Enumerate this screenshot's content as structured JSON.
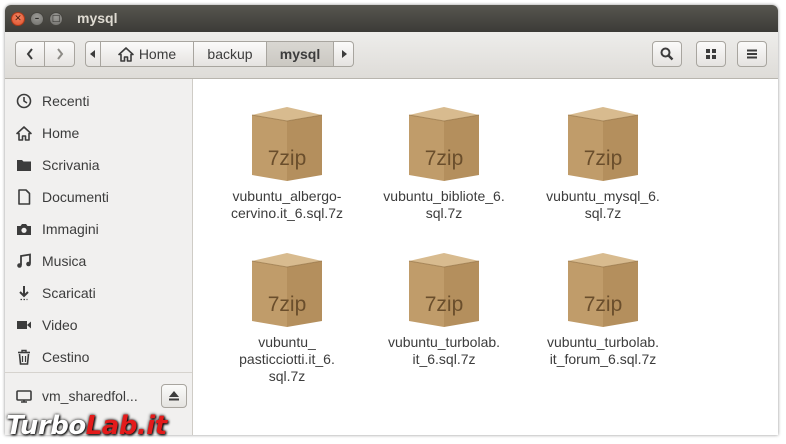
{
  "window": {
    "title": "mysql"
  },
  "titlebar_buttons": {
    "close": "✕",
    "minimize": "–",
    "maximize": "□"
  },
  "breadcrumb": {
    "home": "Home",
    "backup": "backup",
    "mysql": "mysql"
  },
  "sidebar": {
    "items": [
      {
        "label": "Recenti",
        "icon": "clock-icon"
      },
      {
        "label": "Home",
        "icon": "home-icon"
      },
      {
        "label": "Scrivania",
        "icon": "folder-icon"
      },
      {
        "label": "Documenti",
        "icon": "document-icon"
      },
      {
        "label": "Immagini",
        "icon": "camera-icon"
      },
      {
        "label": "Musica",
        "icon": "music-icon"
      },
      {
        "label": "Scaricati",
        "icon": "download-icon"
      },
      {
        "label": "Video",
        "icon": "video-icon"
      },
      {
        "label": "Cestino",
        "icon": "trash-icon"
      }
    ],
    "device": {
      "label": "vm_sharedfol...",
      "icon": "drive-icon"
    }
  },
  "files": [
    {
      "name": "vubuntu_albergo-\ncervino.it_6.sql.7z",
      "icon_label": "7zip"
    },
    {
      "name": "vubuntu_bibliote_6.\nsql.7z",
      "icon_label": "7zip"
    },
    {
      "name": "vubuntu_mysql_6.\nsql.7z",
      "icon_label": "7zip"
    },
    {
      "name": "vubuntu_\npasticciotti.it_6.\nsql.7z",
      "icon_label": "7zip"
    },
    {
      "name": "vubuntu_turbolab.\nit_6.sql.7z",
      "icon_label": "7zip"
    },
    {
      "name": "vubuntu_turbolab.\nit_forum_6.sql.7z",
      "icon_label": "7zip"
    }
  ],
  "watermark": {
    "part1": "Turbo",
    "part2": "Lab.it"
  },
  "colors": {
    "titlebar": "#3c3b37",
    "close_button": "#e0502b",
    "box": "#c4a06f"
  }
}
